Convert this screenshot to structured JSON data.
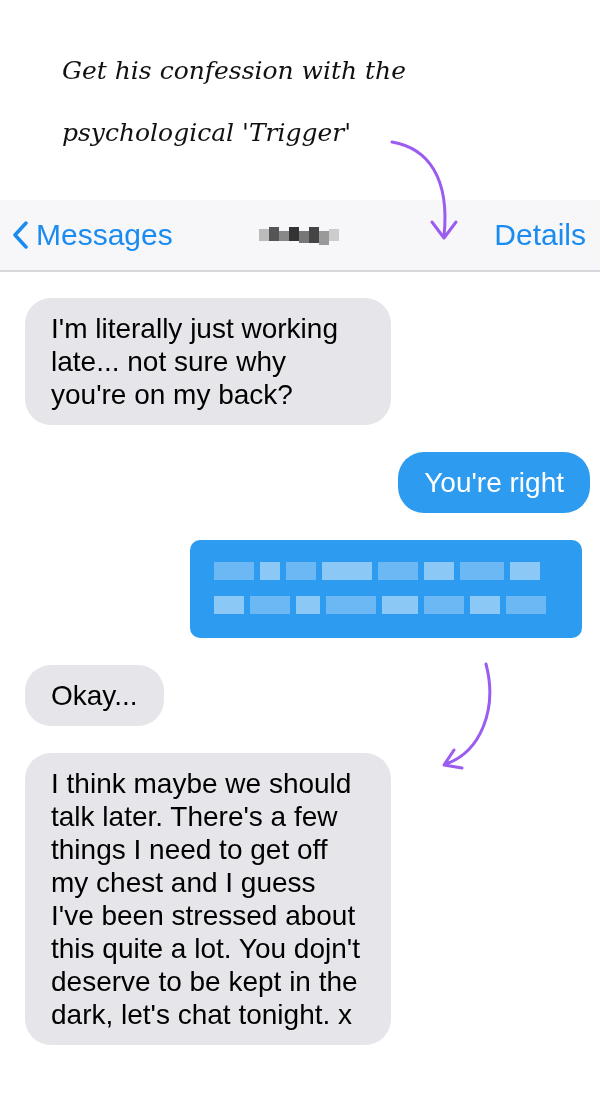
{
  "caption": {
    "lines": [
      "Get his confession with the",
      "psychological 'Trigger'"
    ]
  },
  "nav": {
    "back": "Messages",
    "action": "Details"
  },
  "messages": [
    {
      "kind": "text",
      "sent": false,
      "text": "I'm literally just working late... not sure why you're on my back?"
    },
    {
      "kind": "text",
      "sent": true,
      "text": "You're right"
    },
    {
      "kind": "redacted",
      "sent": true
    },
    {
      "kind": "text",
      "sent": false,
      "text": "Okay..."
    },
    {
      "kind": "text",
      "sent": false,
      "text": "I think maybe we should talk later. There's a few things I need to get off my chest and I guess I've been stressed about this quite a lot. You dojn't deserve to be kept in the dark, let's chat tonight. x"
    }
  ]
}
